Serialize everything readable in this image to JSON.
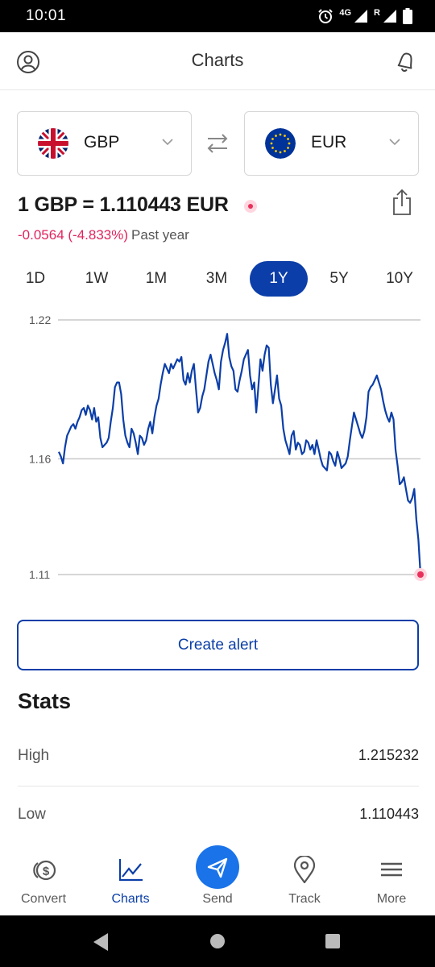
{
  "status_bar": {
    "time": "10:01",
    "network": "4G",
    "roaming": "R"
  },
  "header": {
    "title": "Charts"
  },
  "currency_from": {
    "code": "GBP",
    "flag": "uk-flag"
  },
  "currency_to": {
    "code": "EUR",
    "flag": "eu-flag"
  },
  "rate": {
    "text": "1 GBP = 1.110443 EUR"
  },
  "change": {
    "value": "-0.0564 (-4.833%)",
    "period": "Past year"
  },
  "periods": [
    {
      "label": "1D"
    },
    {
      "label": "1W"
    },
    {
      "label": "1M"
    },
    {
      "label": "3M"
    },
    {
      "label": "1Y",
      "active": true
    },
    {
      "label": "5Y"
    },
    {
      "label": "10Y"
    }
  ],
  "chart_data": {
    "type": "line",
    "ylim": [
      1.11,
      1.22
    ],
    "y_ticks": [
      "1.22",
      "1.16",
      "1.11"
    ],
    "y_tick_values": [
      1.22,
      1.16,
      1.11
    ],
    "grid": true,
    "color": "#0b3ea8",
    "end_marker_color": "#e8315b",
    "series": [
      {
        "values": [
          1.163,
          1.161,
          1.158,
          1.165,
          1.17,
          1.172,
          1.174,
          1.175,
          1.173,
          1.176,
          1.178,
          1.181,
          1.182,
          1.179,
          1.183,
          1.181,
          1.177,
          1.182,
          1.176,
          1.178,
          1.169,
          1.165,
          1.166,
          1.167,
          1.169,
          1.176,
          1.182,
          1.191,
          1.193,
          1.193,
          1.188,
          1.177,
          1.17,
          1.167,
          1.165,
          1.173,
          1.171,
          1.167,
          1.162,
          1.17,
          1.169,
          1.166,
          1.168,
          1.173,
          1.176,
          1.171,
          1.178,
          1.183,
          1.186,
          1.192,
          1.197,
          1.201,
          1.199,
          1.197,
          1.201,
          1.199,
          1.201,
          1.203,
          1.202,
          1.204,
          1.194,
          1.192,
          1.197,
          1.193,
          1.198,
          1.201,
          1.19,
          1.18,
          1.182,
          1.187,
          1.19,
          1.196,
          1.202,
          1.205,
          1.201,
          1.197,
          1.194,
          1.19,
          1.202,
          1.207,
          1.21,
          1.214,
          1.204,
          1.2,
          1.198,
          1.19,
          1.189,
          1.194,
          1.198,
          1.203,
          1.205,
          1.207,
          1.196,
          1.19,
          1.193,
          1.18,
          1.191,
          1.203,
          1.198,
          1.205,
          1.209,
          1.208,
          1.192,
          1.184,
          1.19,
          1.196,
          1.186,
          1.183,
          1.173,
          1.168,
          1.165,
          1.162,
          1.17,
          1.172,
          1.164,
          1.167,
          1.166,
          1.162,
          1.163,
          1.168,
          1.167,
          1.164,
          1.166,
          1.162,
          1.168,
          1.164,
          1.16,
          1.157,
          1.156,
          1.155,
          1.163,
          1.162,
          1.159,
          1.157,
          1.163,
          1.16,
          1.156,
          1.157,
          1.158,
          1.161,
          1.168,
          1.174,
          1.18,
          1.177,
          1.174,
          1.171,
          1.169,
          1.172,
          1.178,
          1.189,
          1.191,
          1.192,
          1.194,
          1.196,
          1.193,
          1.19,
          1.185,
          1.181,
          1.178,
          1.176,
          1.18,
          1.177,
          1.164,
          1.157,
          1.149,
          1.15,
          1.152,
          1.147,
          1.142,
          1.141,
          1.143,
          1.147,
          1.134,
          1.125,
          1.11
        ]
      }
    ]
  },
  "actions": {
    "create_alert": "Create alert"
  },
  "stats": {
    "title": "Stats",
    "rows": [
      {
        "label": "High",
        "value": "1.215232"
      },
      {
        "label": "Low",
        "value": "1.110443"
      }
    ]
  },
  "nav": [
    {
      "label": "Convert",
      "icon": "convert-coins-icon"
    },
    {
      "label": "Charts",
      "icon": "charts-icon",
      "active": true
    },
    {
      "label": "Send",
      "icon": "send-icon"
    },
    {
      "label": "Track",
      "icon": "location-pin-icon"
    },
    {
      "label": "More",
      "icon": "menu-icon"
    }
  ],
  "colors": {
    "brand": "#0b3ea8",
    "send": "#1a73e8",
    "negative": "#e0245e"
  }
}
